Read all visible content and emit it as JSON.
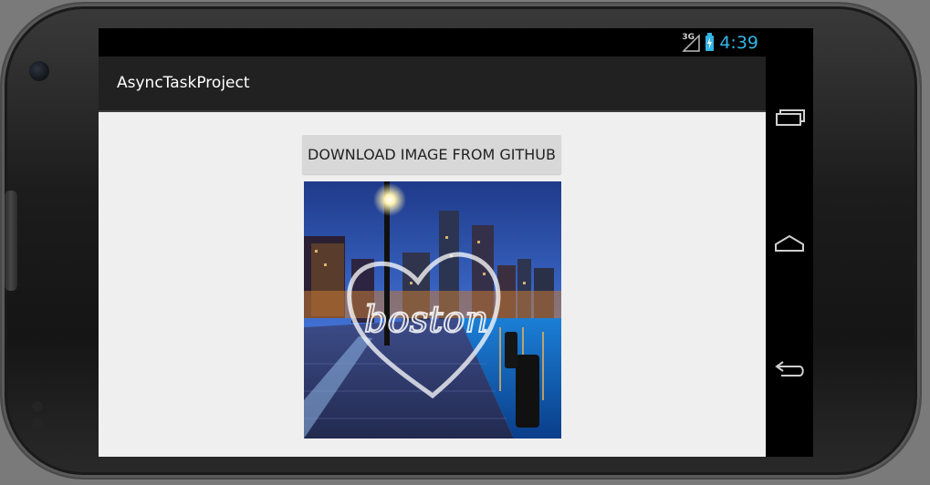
{
  "status_bar": {
    "network": "3G",
    "time": "4:39",
    "accent_color": "#33b5e5"
  },
  "action_bar": {
    "title": "AsyncTaskProject"
  },
  "content": {
    "download_button_label": "DOWNLOAD IMAGE FROM GITHUB",
    "image_overlay_text": "boston"
  },
  "nav_bar": {
    "icons": [
      "recent-apps-icon",
      "home-icon",
      "back-icon"
    ]
  }
}
